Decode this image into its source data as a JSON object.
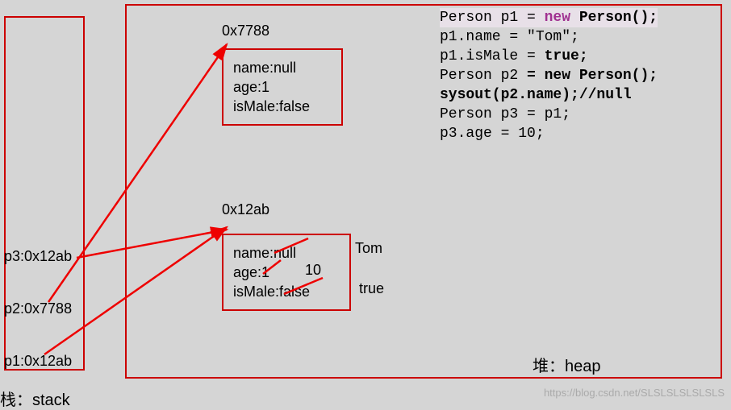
{
  "stack": {
    "label": "栈：stack",
    "items": [
      "p3:0x12ab",
      "p2:0x7788",
      "p1:0x12ab"
    ]
  },
  "heap": {
    "label": "堆：heap",
    "objects": [
      {
        "address": "0x7788",
        "fields": [
          "name:null",
          "age:1",
          "isMale:false"
        ]
      },
      {
        "address": "0x12ab",
        "fields": [
          "name:null",
          "age:1",
          "isMale:false"
        ],
        "replacements": {
          "name": "Tom",
          "age": "10",
          "isMale": "true"
        }
      }
    ]
  },
  "code": {
    "l1_pre": "Person p1 = ",
    "l1_new": "new",
    "l1_post": " Person();",
    "l2": "p1.name = \"Tom\";",
    "l3_pre": "p1.isMale = ",
    "l3_b": "true;",
    "l4_pre": "Person p2 ",
    "l4_b": "= new Person();",
    "l5_b": "sysout(p2.name);//null",
    "l6": "Person p3 = p1;",
    "l7": "p3.age = 10;"
  },
  "watermark": "https://blog.csdn.net/SLSLSLSLSLSLS"
}
